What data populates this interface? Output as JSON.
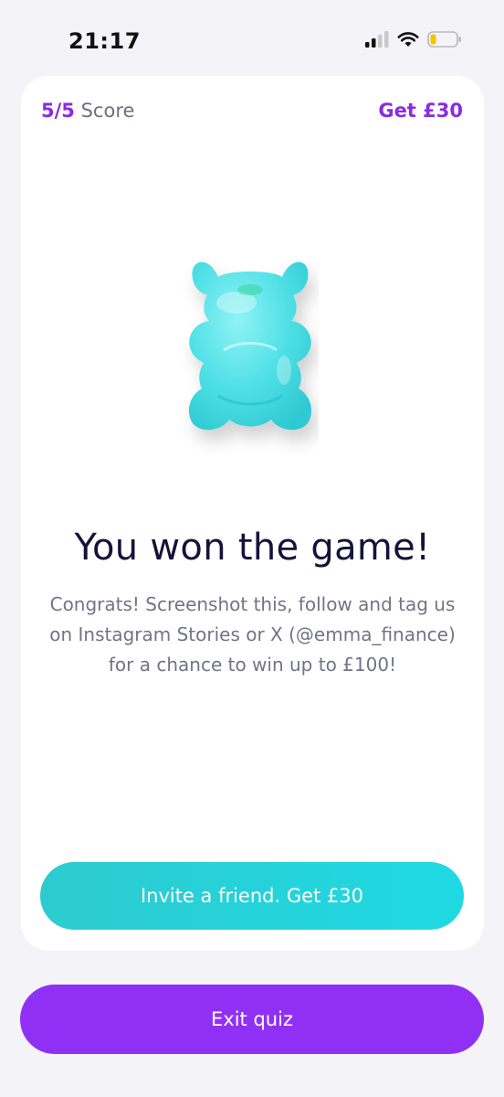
{
  "status_bar": {
    "time": "21:17",
    "signal_icon": "cellular-signal-icon",
    "wifi_icon": "wifi-icon",
    "battery_icon": "battery-low-icon",
    "battery_color": "#f5c400"
  },
  "header": {
    "score_value": "5/5",
    "score_label": "Score",
    "reward_link": "Get £30"
  },
  "illustration": {
    "icon": "gummy-bear-icon",
    "color": "#4fe0e6"
  },
  "main": {
    "title": "You won the game!",
    "message": "Congrats! Screenshot this, follow and tag us on Instagram Stories or X (@emma_finance) for a chance to win up to £100!"
  },
  "actions": {
    "invite_label": "Invite a friend. Get £30",
    "exit_label": "Exit quiz"
  },
  "colors": {
    "accent_purple": "#9130f5",
    "accent_teal": "#22d3dc",
    "background": "#f4f4f8"
  }
}
